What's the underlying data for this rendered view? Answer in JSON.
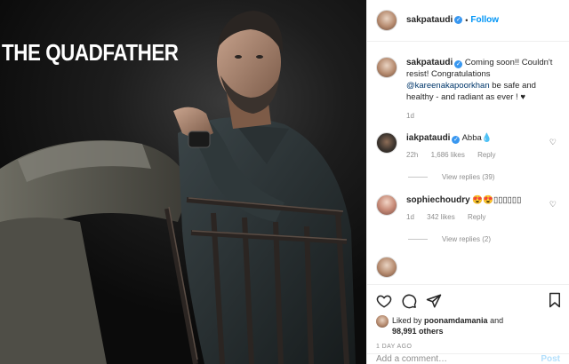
{
  "photo": {
    "caption": "THE QUADFATHER"
  },
  "header": {
    "username": "sakpataudi",
    "separator": "•",
    "follow_label": "Follow"
  },
  "caption_entry": {
    "username": "sakpataudi",
    "text_before": "Coming soon!! Couldn't resist! Congratulations",
    "mention": "@kareenakapoorkhan",
    "text_after": "be safe and healthy - and radiant as ever ! ♥",
    "time": "1d"
  },
  "comments": [
    {
      "username": "iakpataudi",
      "text": "Abba💧",
      "time": "22h",
      "likes": "1,686 likes",
      "reply_label": "Reply",
      "view_replies": "View replies (39)"
    },
    {
      "username": "sophiechoudry",
      "text": "😍😍▯▯▯▯▯▯",
      "time": "1d",
      "likes": "342 likes",
      "reply_label": "Reply",
      "view_replies": "View replies (2)"
    }
  ],
  "actions": {
    "liked_by_prefix": "Liked by",
    "liked_by_user": "poonamdamania",
    "liked_by_suffix": "and",
    "others_count": "98,991 others",
    "timestamp": "1 DAY AGO"
  },
  "add_comment": {
    "placeholder": "Add a comment…",
    "post_label": "Post"
  },
  "icons": {
    "like": "heart-outline-icon",
    "comment": "comment-bubble-icon",
    "share": "paper-plane-icon",
    "save": "bookmark-icon",
    "verified": "verified-badge-icon"
  },
  "colors": {
    "link_blue": "#0095f6",
    "verified_blue": "#3897f0",
    "muted": "#8e8e8e",
    "post_disabled": "#b2dffc"
  }
}
